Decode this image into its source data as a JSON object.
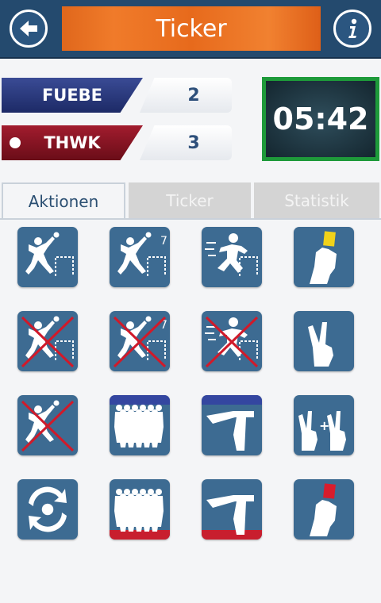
{
  "header": {
    "title": "Ticker",
    "back_icon": "back-arrow-icon",
    "info_icon": "info-icon"
  },
  "teams": {
    "home": {
      "name": "FUEBE",
      "score": "2",
      "color": "#25347a"
    },
    "away": {
      "name": "THWK",
      "score": "3",
      "color": "#8c1424"
    }
  },
  "clock": "05:42",
  "tabs": [
    {
      "label": "Aktionen",
      "active": true
    },
    {
      "label": "Ticker",
      "active": false
    },
    {
      "label": "Statistik",
      "active": false
    }
  ],
  "actions": [
    {
      "icon": "goal-icon"
    },
    {
      "icon": "seven-meter-goal-icon",
      "text": "7"
    },
    {
      "icon": "fast-break-goal-icon"
    },
    {
      "icon": "yellow-card-icon"
    },
    {
      "icon": "missed-shot-icon"
    },
    {
      "icon": "missed-seven-meter-icon",
      "text": "7"
    },
    {
      "icon": "missed-fast-break-icon"
    },
    {
      "icon": "two-minute-penalty-icon"
    },
    {
      "icon": "technical-fault-icon"
    },
    {
      "icon": "home-team-timeout-icon"
    },
    {
      "icon": "home-timeout-signal-icon"
    },
    {
      "icon": "double-two-minute-penalty-icon"
    },
    {
      "icon": "substitution-icon"
    },
    {
      "icon": "away-team-timeout-icon"
    },
    {
      "icon": "away-timeout-signal-icon"
    },
    {
      "icon": "red-card-icon"
    }
  ]
}
